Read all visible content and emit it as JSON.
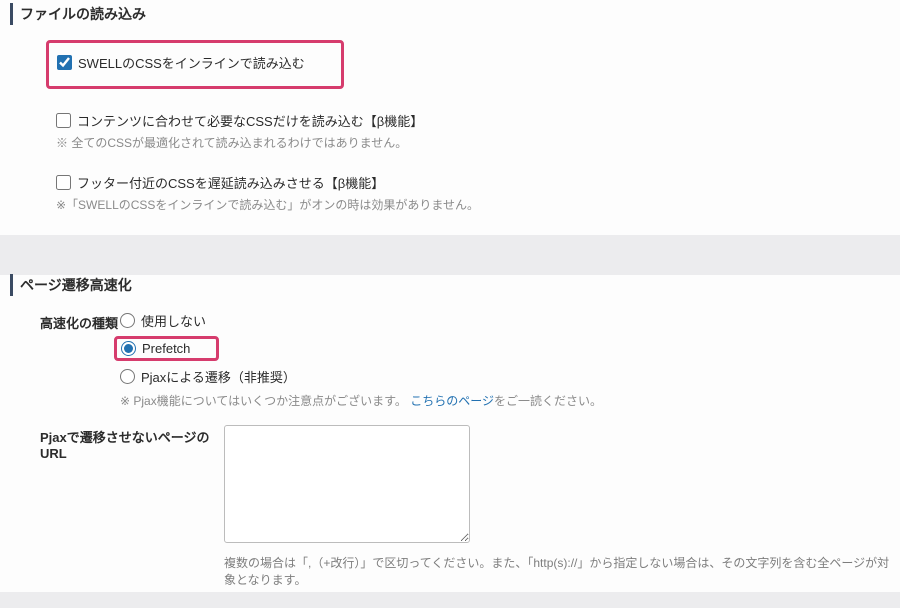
{
  "section_file_load": {
    "title": "ファイルの読み込み",
    "opt_inline": {
      "label": "SWELLのCSSをインラインで読み込む",
      "checked": true
    },
    "opt_content_css": {
      "label": "コンテンツに合わせて必要なCSSだけを読み込む【β機能】",
      "checked": false,
      "note": "※ 全てのCSSが最適化されて読み込まれるわけではありません。"
    },
    "opt_footer_css": {
      "label": "フッター付近のCSSを遅延読み込みさせる【β機能】",
      "checked": false,
      "note": "※「SWELLのCSSをインラインで読み込む」がオンの時は効果がありません。"
    }
  },
  "section_page_speed": {
    "title": "ページ遷移高速化",
    "type_label": "高速化の種類",
    "options": {
      "none": "使用しない",
      "prefetch": "Prefetch",
      "pjax": "Pjaxによる遷移（非推奨）"
    },
    "selected": "prefetch",
    "pjax_note_prefix": "※ Pjax機能についてはいくつか注意点がございます。",
    "pjax_note_link": "こちらのページ",
    "pjax_note_suffix": "をご一読ください。",
    "exclude_label": "Pjaxで遷移させないページのURL",
    "exclude_value": "",
    "exclude_note": "複数の場合は「,（+改行）」で区切ってください。また、「http(s)://」から指定しない場合は、その文字列を含む全ページが対象となります。"
  }
}
